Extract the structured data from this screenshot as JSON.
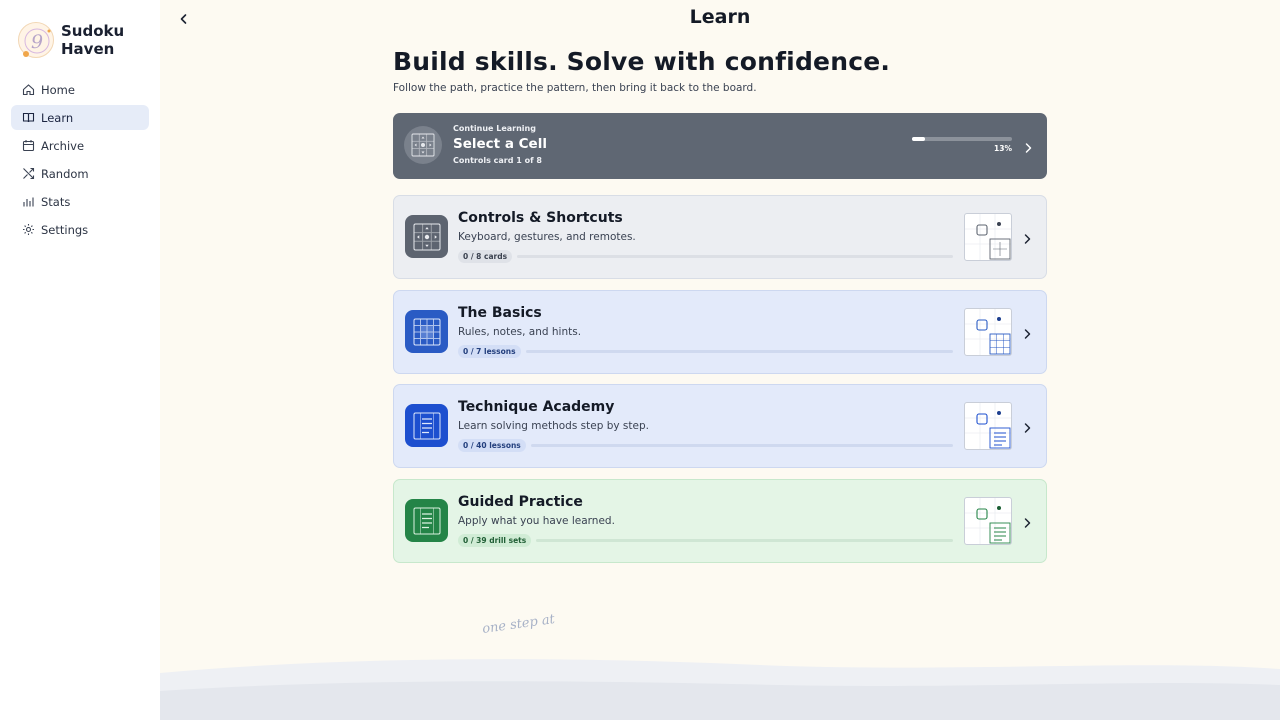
{
  "brand": {
    "name": "Sudoku Haven"
  },
  "nav": {
    "items": [
      {
        "label": "Home",
        "icon": "home-icon"
      },
      {
        "label": "Learn",
        "icon": "book-icon"
      },
      {
        "label": "Archive",
        "icon": "calendar-icon"
      },
      {
        "label": "Random",
        "icon": "shuffle-icon"
      },
      {
        "label": "Stats",
        "icon": "bar-chart-icon"
      },
      {
        "label": "Settings",
        "icon": "gear-icon"
      }
    ],
    "active": "Learn"
  },
  "header": {
    "title": "Learn"
  },
  "hero": {
    "title": "Build skills. Solve with confidence.",
    "subtitle": "Follow the path, practice the pattern, then bring it back to the board."
  },
  "continue": {
    "kicker": "Continue Learning",
    "title": "Select a Cell",
    "meta": "Controls card 1 of 8",
    "progress_percent": 13,
    "progress_label": "13%"
  },
  "cards": [
    {
      "title": "Controls & Shortcuts",
      "desc": "Keyboard, gestures, and remotes.",
      "badge": "0 / 8 cards",
      "progress": 0,
      "icon": "dpad-grid-icon"
    },
    {
      "title": "The Basics",
      "desc": "Rules, notes, and hints.",
      "badge": "0 / 7 lessons",
      "progress": 0,
      "icon": "grid-icon"
    },
    {
      "title": "Technique Academy",
      "desc": "Learn solving methods step by step.",
      "badge": "0 / 40 lessons",
      "progress": 0,
      "icon": "list-grid-icon"
    },
    {
      "title": "Guided Practice",
      "desc": "Apply what you have learned.",
      "badge": "0 / 39 drill sets",
      "progress": 0,
      "icon": "list-grid-icon"
    }
  ],
  "footer": {
    "script": "one step at"
  },
  "colors": {
    "accent": "#2a5bc4",
    "continue_bg": "#5f6773",
    "practice": "#248447"
  }
}
